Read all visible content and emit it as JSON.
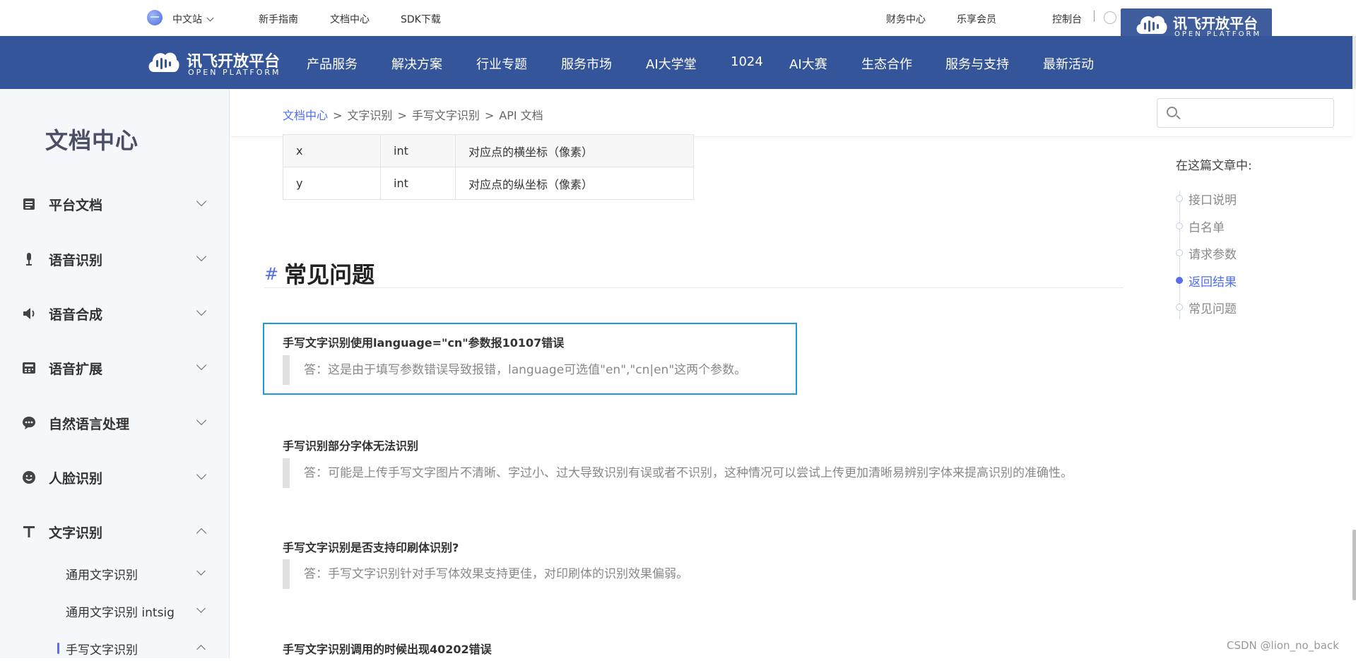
{
  "topbar": {
    "locale_label": "中文站",
    "links": [
      "新手指南",
      "文档中心",
      "SDK下载"
    ],
    "right_links": [
      "财务中心",
      "乐享会员",
      "控制台"
    ]
  },
  "brand": {
    "name": "讯飞开放平台",
    "sub": "OPEN PLATFORM"
  },
  "nav": {
    "items": [
      "产品服务",
      "解决方案",
      "行业专题",
      "服务市场",
      "AI大学堂",
      "1024",
      "AI大赛",
      "生态合作",
      "服务与支持",
      "最新活动"
    ]
  },
  "sidebar": {
    "title": "文档中心",
    "items": [
      {
        "label": "平台文档",
        "icon": "document-icon"
      },
      {
        "label": "语音识别",
        "icon": "microphone-icon"
      },
      {
        "label": "语音合成",
        "icon": "speaker-icon"
      },
      {
        "label": "语音扩展",
        "icon": "calculator-icon"
      },
      {
        "label": "自然语言处理",
        "icon": "chat-bubble-icon"
      },
      {
        "label": "人脸识别",
        "icon": "smiley-icon"
      },
      {
        "label": "文字识别",
        "icon": "text-t-icon"
      }
    ],
    "sub_items": [
      "通用文字识别",
      "通用文字识别 intsig",
      "手写文字识别"
    ]
  },
  "breadcrumb": {
    "items": [
      "文档中心",
      "文字识别",
      "手写文字识别",
      "API 文档"
    ],
    "separator": ">"
  },
  "search": {
    "placeholder": ""
  },
  "params_table": {
    "rows": [
      [
        "x",
        "int",
        "对应点的横坐标（像素）"
      ],
      [
        "y",
        "int",
        "对应点的纵坐标（像素）"
      ]
    ]
  },
  "section": {
    "hash": "#",
    "title": "常见问题"
  },
  "faq": [
    {
      "q": "手写文字识别使用language=\"cn\"参数报10107错误",
      "a": "答：这是由于填写参数错误导致报错，language可选值\"en\",\"cn|en\"这两个参数。"
    },
    {
      "q": "手写识别部分字体无法识别",
      "a": "答：可能是上传手写文字图片不清晰、字过小、过大导致识别有误或者不识别，这种情况可以尝试上传更加清晰易辨别字体来提高识别的准确性。"
    },
    {
      "q": "手写文字识别是否支持印刷体识别?",
      "a": "答：手写文字识别针对手写体效果支持更佳，对印刷体的识别效果偏弱。"
    },
    {
      "q": "手写文字识别调用的时候出现40202错误",
      "a": ""
    }
  ],
  "toc": {
    "title": "在这篇文章中:",
    "items": [
      "接口说明",
      "白名单",
      "请求参数",
      "返回结果",
      "常见问题"
    ],
    "active_index": 3
  },
  "watermark": "CSDN @lion_no_back",
  "colors": {
    "nav_bg": "#35559a",
    "accent": "#4e6ef2",
    "highlight_border": "#1a9cd8"
  }
}
